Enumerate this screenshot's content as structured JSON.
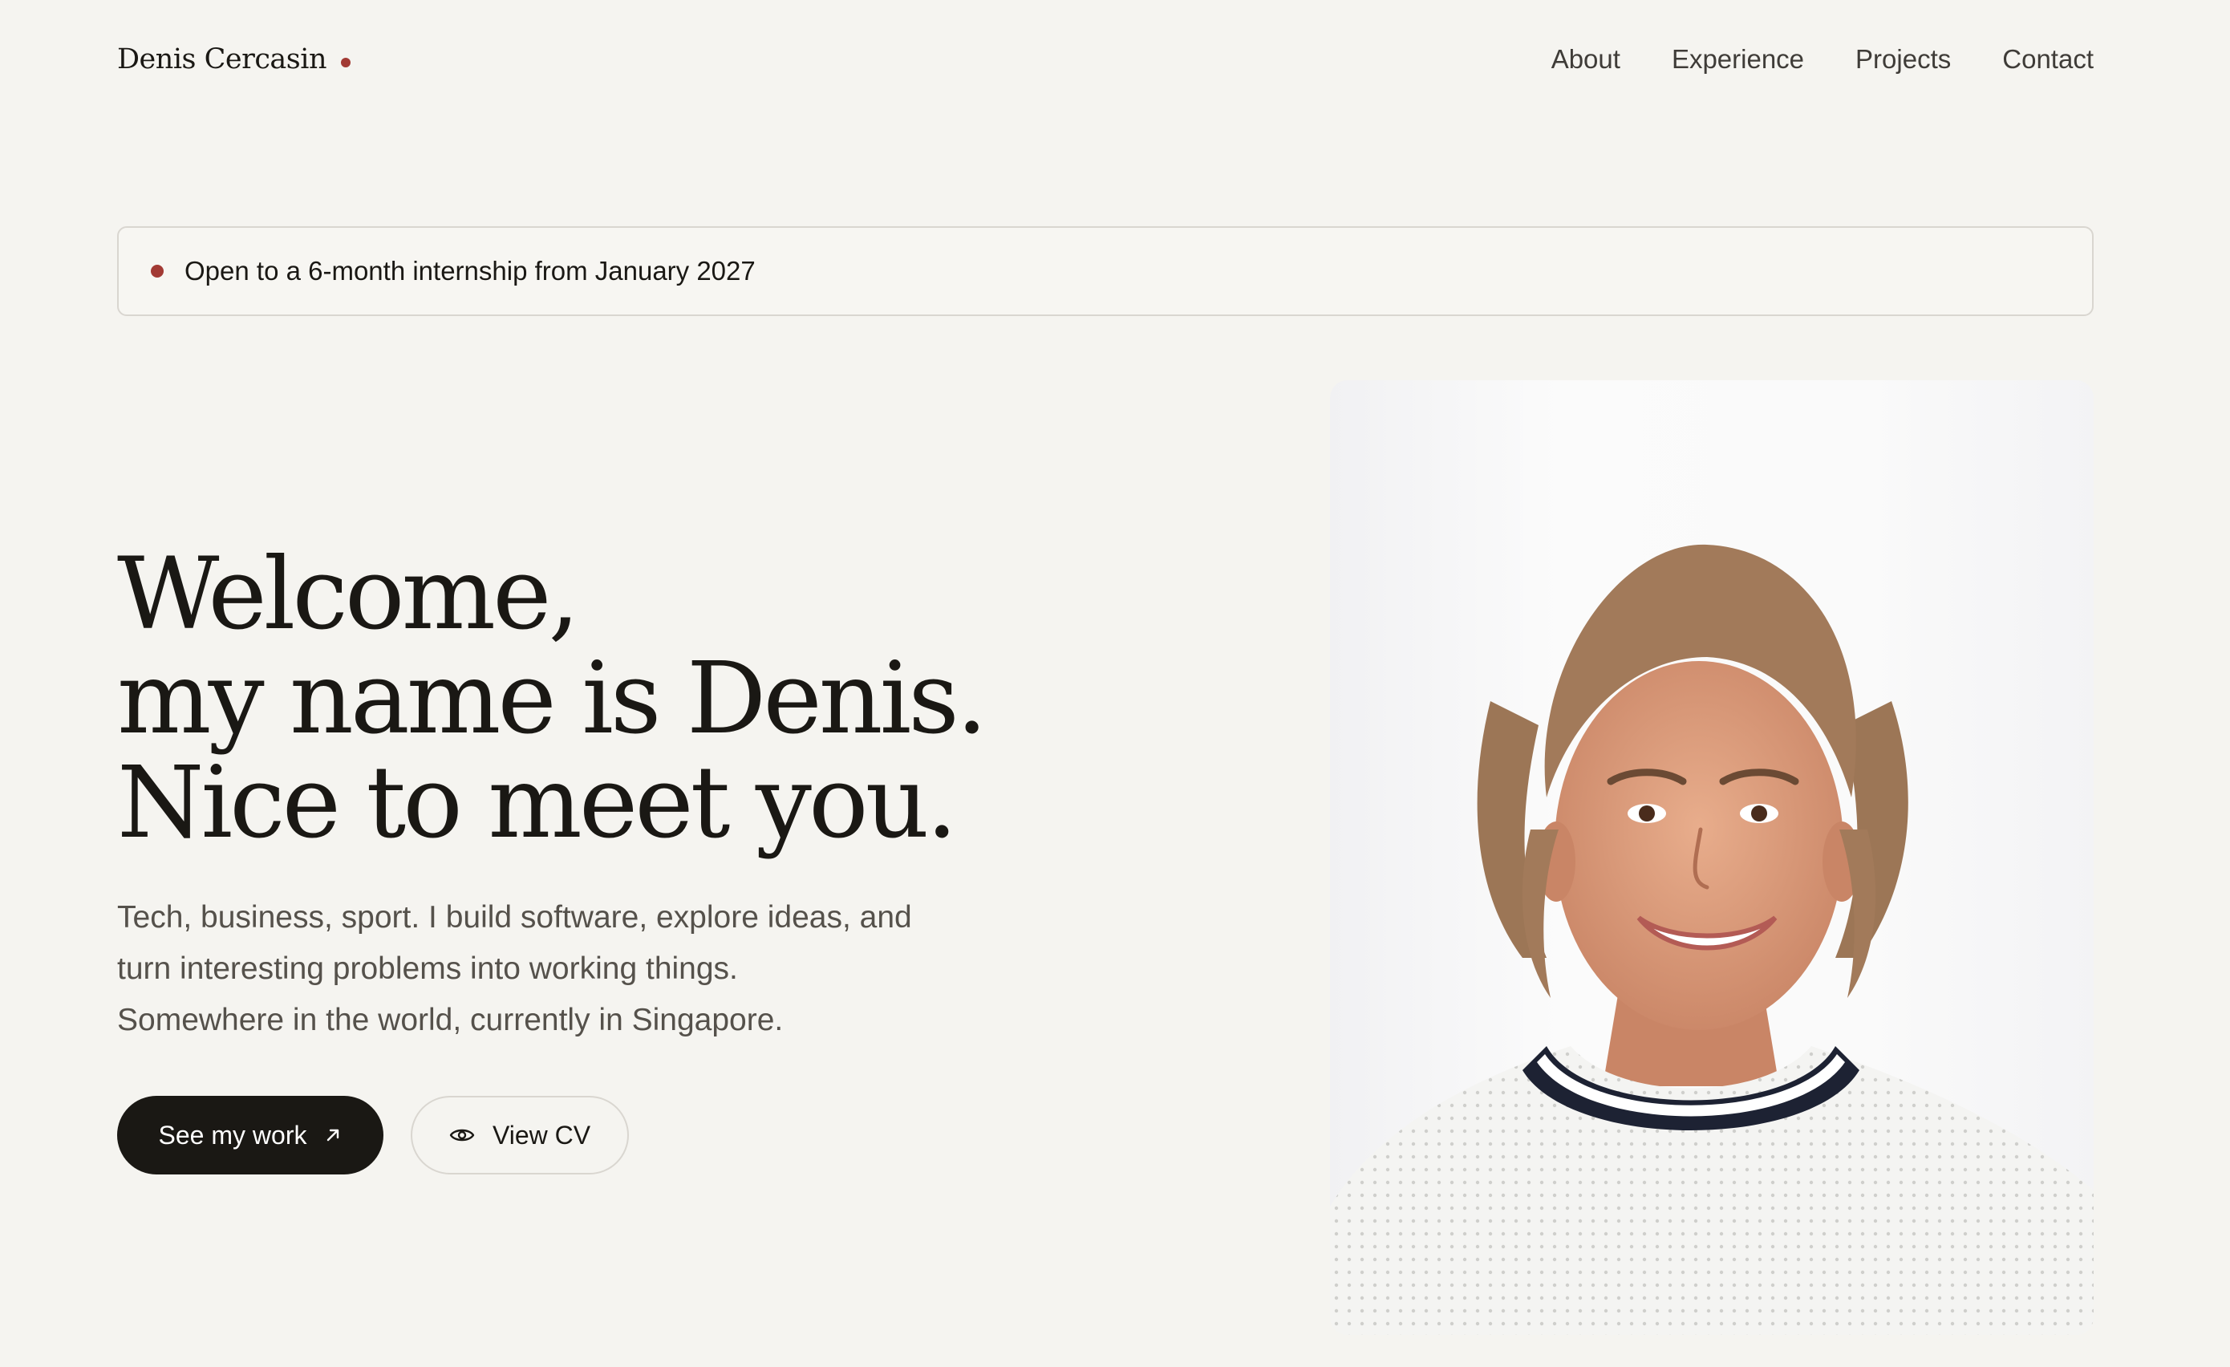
{
  "header": {
    "brand": "Denis Cercasin",
    "nav": [
      {
        "label": "About"
      },
      {
        "label": "Experience"
      },
      {
        "label": "Projects"
      },
      {
        "label": "Contact"
      }
    ]
  },
  "banner": {
    "text": "Open to a 6-month internship from January 2027"
  },
  "hero": {
    "title_lines": [
      "Welcome,",
      "my name is Denis.",
      "Nice to meet you."
    ],
    "description_lines": [
      "Tech, business, sport. I build software, explore ideas, and",
      "turn interesting problems into working things.",
      "Somewhere in the world, currently in Singapore."
    ],
    "primary_button": {
      "label": "See my work",
      "icon": "arrow-up-right-icon"
    },
    "secondary_button": {
      "label": "View CV",
      "icon": "eye-icon"
    }
  },
  "colors": {
    "background": "#f5f4f0",
    "text": "#1a1814",
    "accent": "#a23a34",
    "muted_text": "#55514b"
  }
}
